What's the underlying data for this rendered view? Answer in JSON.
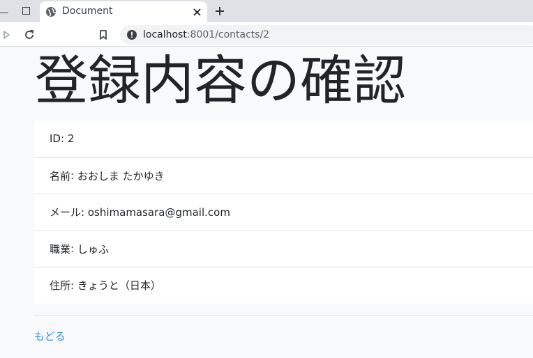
{
  "browser": {
    "tab": {
      "title": "Document",
      "favicon": "globe-icon"
    },
    "toolbar": {
      "icons": [
        "forward-icon",
        "reload-icon",
        "bookmark-icon",
        "info-icon"
      ],
      "url_host": "localhost",
      "url_path": ":8001/contacts/2"
    }
  },
  "page": {
    "title": "登録内容の確認",
    "details": [
      {
        "label": "ID",
        "separator": ": ",
        "value": "2"
      },
      {
        "label": "名前",
        "separator": ": ",
        "value": "おおしま たかゆき"
      },
      {
        "label": "メール",
        "separator": ": ",
        "value": "oshimamasara@gmail.com"
      },
      {
        "label": "職業",
        "separator": ": ",
        "value": "しゅふ"
      },
      {
        "label": "住所",
        "separator": ": ",
        "value": "きょうと（日本）"
      }
    ],
    "back_link": "もどる"
  },
  "colors": {
    "link": "#3490dc",
    "page_bg": "#f8f9fa",
    "text": "#212529"
  }
}
